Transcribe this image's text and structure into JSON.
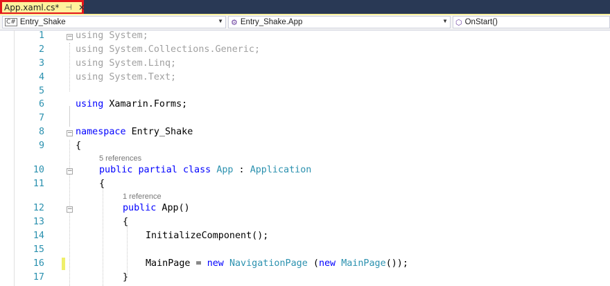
{
  "tab": {
    "title": "App.xaml.cs*",
    "pin": "⊣",
    "close": "✕"
  },
  "nav": {
    "project": "Entry_Shake",
    "project_icon": "C#",
    "class": "Entry_Shake.App",
    "member": "OnStart()"
  },
  "lens": {
    "refs5": "5 references",
    "refs1": "1 reference"
  },
  "lines": {
    "l1": "1",
    "l2": "2",
    "l3": "3",
    "l4": "4",
    "l5": "5",
    "l6": "6",
    "l7": "7",
    "l8": "8",
    "l9": "9",
    "l10": "10",
    "l11": "11",
    "l12": "12",
    "l13": "13",
    "l14": "14",
    "l15": "15",
    "l16": "16",
    "l17": "17"
  },
  "code": {
    "using": "using",
    "sys": " System;",
    "sysColl": " System.Collections.Generic;",
    "sysLinq": " System.Linq;",
    "sysText": " System.Text;",
    "xf": " Xamarin.Forms;",
    "namespace": "namespace",
    "nsName": " Entry_Shake",
    "brace_open": "{",
    "brace_close": "}",
    "public": "public",
    "partial": "partial",
    "class": "class",
    "App": "App",
    "colon": " : ",
    "Application": "Application",
    "ctor": " App()",
    "init": "InitializeComponent();",
    "mainpage": "MainPage = ",
    "new": "new",
    "NavigationPage": "NavigationPage",
    "paren_open": " (",
    "MainPage": "MainPage",
    "tail": "());"
  },
  "colors": {
    "keyword": "#0000ff",
    "type": "#2b91af",
    "tab_bg": "#fff29d",
    "highlight_border": "#e3161b"
  }
}
